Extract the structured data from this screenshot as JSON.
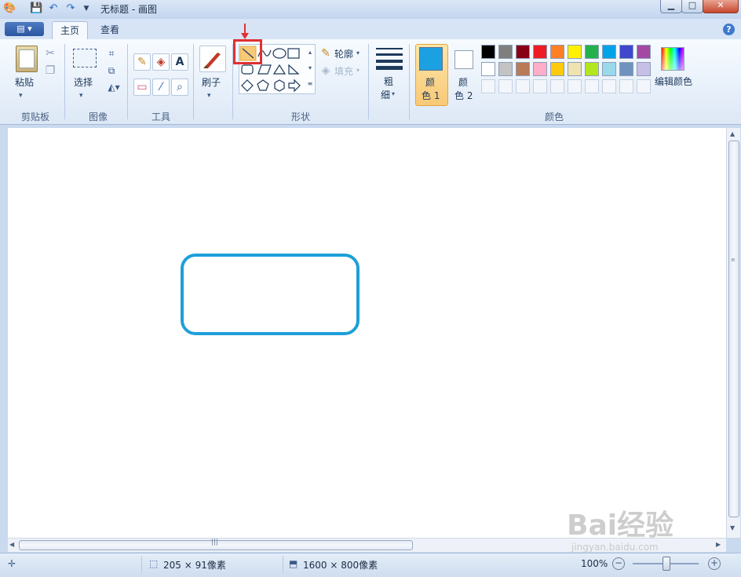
{
  "window": {
    "title": "无标题 - 画图",
    "minimize": "▁",
    "maximize": "□",
    "close": "✕"
  },
  "tabs": {
    "home": "主页",
    "view": "查看"
  },
  "groups": {
    "clipboard": "剪贴板",
    "image": "图像",
    "tools": "工具",
    "shapes": "形状",
    "colors": "颜色"
  },
  "clipboard": {
    "paste": "粘贴"
  },
  "image": {
    "select": "选择"
  },
  "brushes": {
    "label": "刷子"
  },
  "shapes": {
    "outline": "轮廓",
    "fill": "填充"
  },
  "size": {
    "line1": "粗",
    "line2": "细"
  },
  "color1": {
    "line1": "颜",
    "line2": "色 1",
    "value": "#1ba1e2"
  },
  "color2": {
    "line1": "颜",
    "line2": "色 2",
    "value": "#ffffff"
  },
  "edit_colors": "编辑颜色",
  "palette_row1": [
    "#000000",
    "#7f7f7f",
    "#880015",
    "#ed1c24",
    "#ff7f27",
    "#fff200",
    "#22b14c",
    "#00a2e8",
    "#3f48cc",
    "#a349a4"
  ],
  "palette_row2": [
    "#ffffff",
    "#c3c3c3",
    "#b97a57",
    "#ffaec9",
    "#ffc90e",
    "#efe4b0",
    "#b5e61d",
    "#99d9ea",
    "#7092be",
    "#c8bfe7"
  ],
  "status": {
    "selection_size": "205 × 91像素",
    "canvas_size": "1600 × 800像素",
    "zoom": "100%"
  },
  "drawing": {
    "shape": "rounded-rectangle",
    "stroke": "#1e9fd8"
  },
  "watermark": {
    "logo": "Bai经验",
    "url": "jingyan.baidu.com"
  },
  "highlight": {
    "color": "#e03030"
  }
}
